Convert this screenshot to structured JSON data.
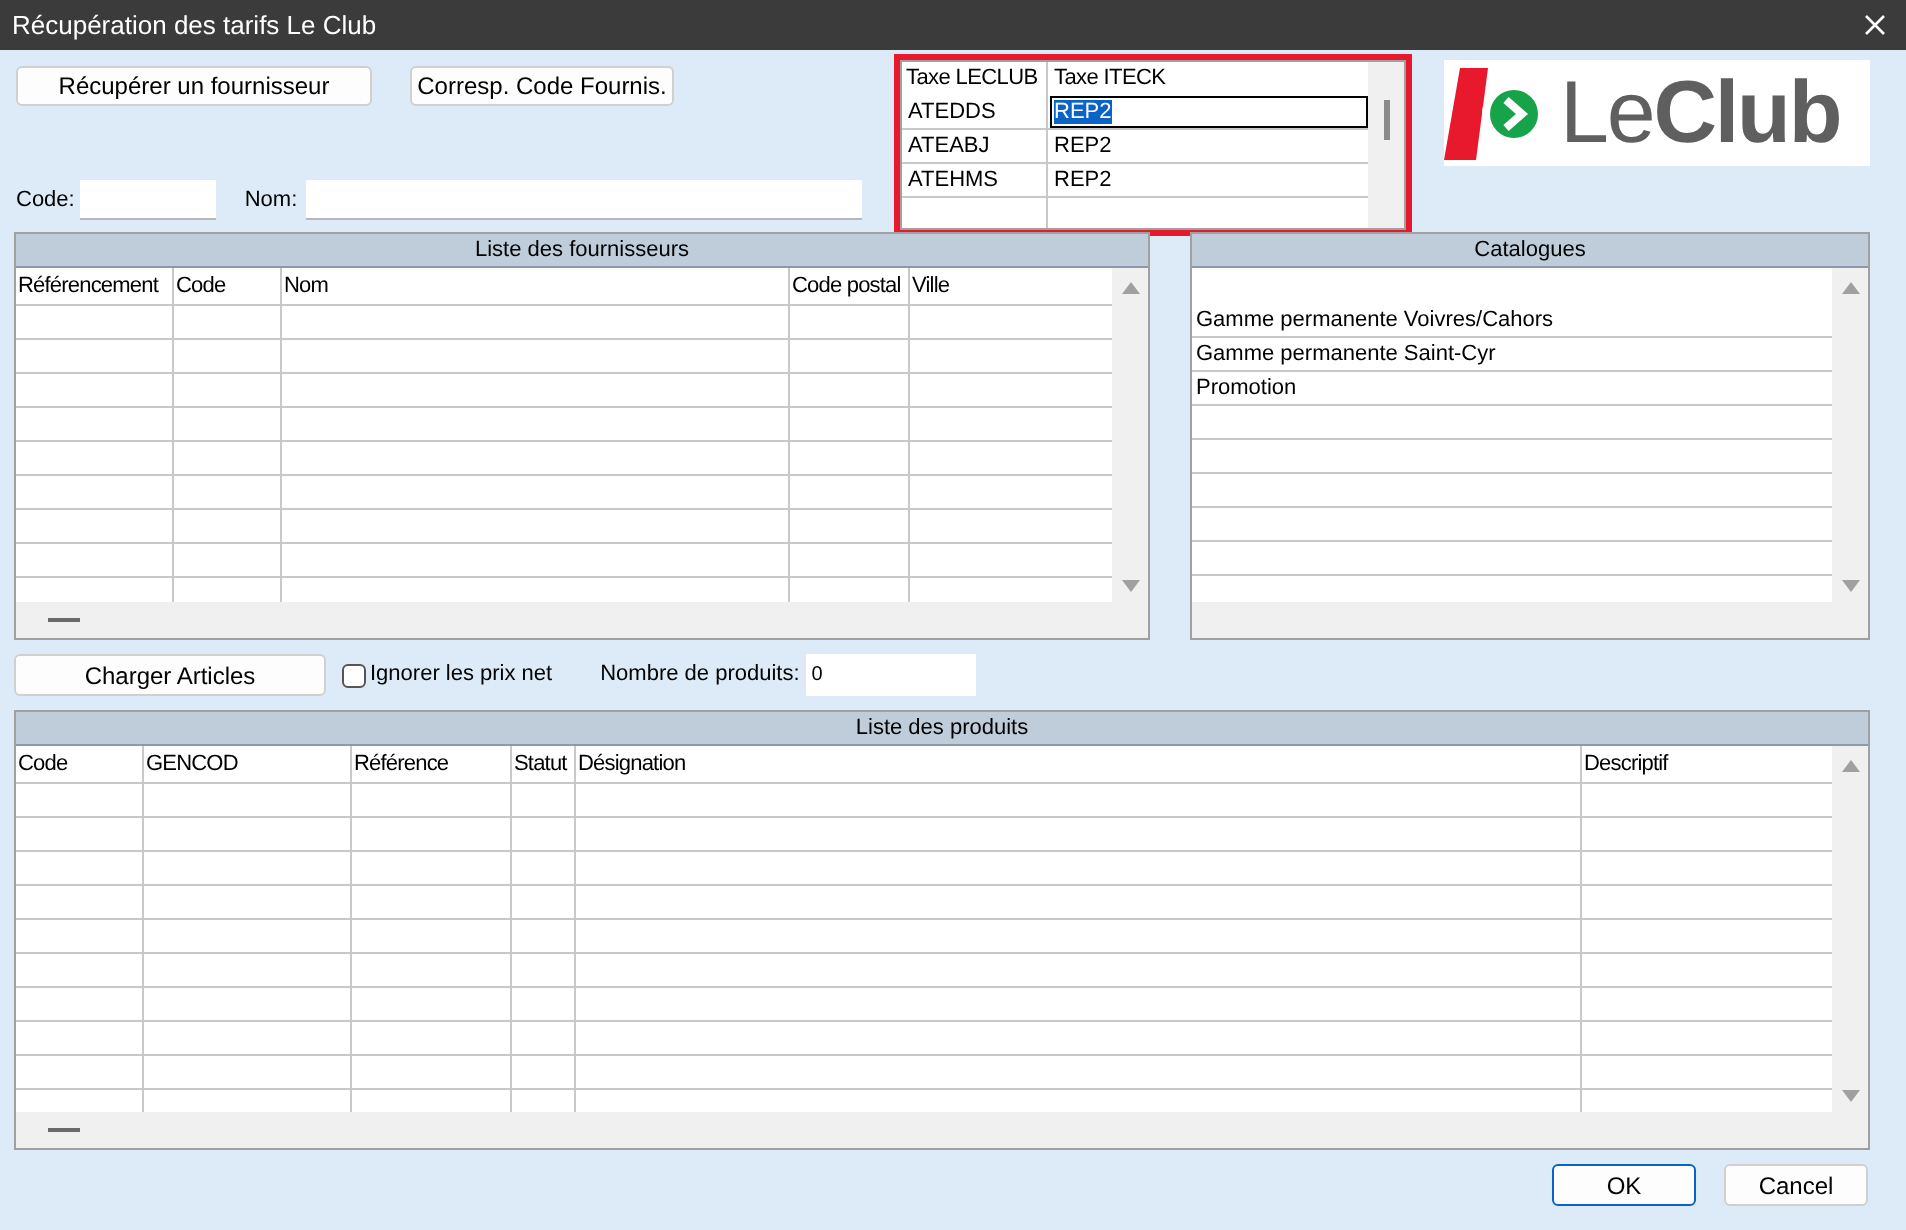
{
  "window": {
    "title": "Récupération des tarifs Le Club"
  },
  "top_buttons": [
    {
      "label": "Récupérer un fournisseur"
    },
    {
      "label": "Corresp. Code Fournis."
    }
  ],
  "filters": [
    {
      "label": "Code:"
    },
    {
      "label": "Nom:"
    }
  ],
  "tax_grid": {
    "highlighted": true,
    "columns": [
      "Taxe LECLUB",
      "Taxe ITECK"
    ],
    "rows": [
      {
        "cells": [
          "ATEDDS",
          "REP2"
        ],
        "editing": true
      },
      {
        "cells": [
          "ATEABJ",
          "REP2"
        ],
        "editing": false
      },
      {
        "cells": [
          "ATEHMS",
          "REP2"
        ],
        "editing": false
      }
    ]
  },
  "logo": {
    "text": "Le**Club**"
  },
  "suppliers": {
    "title": "Liste des fournisseurs",
    "columns": [
      "Référencement",
      "Code",
      "Nom",
      "Code postal",
      "Ville"
    ]
  },
  "catalogues": {
    "title": "Catalogues",
    "items": [
      "Gamme permanente Voivres/Cahors",
      "Gamme permanente Saint-Cyr",
      "Promotion"
    ]
  },
  "load_button": {
    "label": "Charger Articles"
  },
  "ignore_net": {
    "label": "Ignorer les prix net",
    "checked": false
  },
  "product_count": {
    "label": "Nombre de produits:",
    "value": "0"
  },
  "products": {
    "title": "Liste des produits",
    "columns": [
      "Code",
      "GENCOD",
      "Référence",
      "Statut",
      "Désignation",
      "Descriptif"
    ]
  },
  "footer_buttons": [
    {
      "label": "OK",
      "default": true
    },
    {
      "label": "Cancel",
      "default": false
    }
  ]
}
